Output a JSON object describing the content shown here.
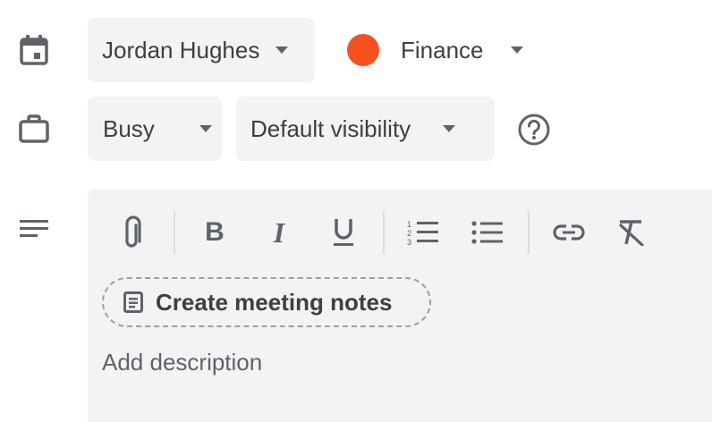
{
  "owner": {
    "name": "Jordan Hughes"
  },
  "calendar": {
    "name": "Finance",
    "color": "#f4511e"
  },
  "status": {
    "availability": "Busy",
    "visibility": "Default visibility"
  },
  "editor": {
    "toolbar": [
      "attach-icon",
      "bold-icon",
      "italic-icon",
      "underline-icon",
      "numbered-list-icon",
      "bulleted-list-icon",
      "link-icon",
      "clear-formatting-icon"
    ],
    "notes_button_label": "Create meeting notes",
    "description_placeholder": "Add description"
  },
  "colors": {
    "panel_bg": "#f1f3f4",
    "icon": "#5f6368",
    "text": "#3c4043"
  }
}
